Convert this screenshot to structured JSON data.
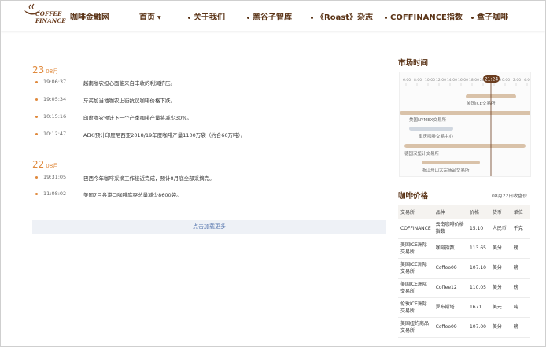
{
  "header": {
    "logo_text": "COFFEE\nFINANCE",
    "site_name": "咖啡金融网",
    "nav": [
      {
        "label": "首页"
      },
      {
        "label": "关于我们"
      },
      {
        "label": "黑谷子智库"
      },
      {
        "label": "《Roast》杂志"
      },
      {
        "label": "COFFINANCE指数"
      },
      {
        "label": "盒子咖啡"
      }
    ]
  },
  "news": {
    "groups": [
      {
        "day": "23",
        "month": "08月",
        "items": [
          {
            "time": "19:06:37",
            "title": "越南咖农担心面临来自丰收的利润挤压。"
          },
          {
            "time": "19:05:34",
            "title": "牙买加当地咖农上街抗议咖啡价格下跌。"
          },
          {
            "time": "10:15:16",
            "title": "印度咖农预计下一个产季咖啡产量将减少30%。"
          },
          {
            "time": "10:12:47",
            "title": "AEKI预计印度尼西亚2018/19年度咖啡产量1100万袋（约合66万吨）。"
          }
        ]
      },
      {
        "day": "22",
        "month": "08月",
        "items": [
          {
            "time": "19:31:05",
            "title": "巴西今年咖啡采摘工作接近完成，预计8月底全部采摘完。"
          },
          {
            "time": "11:08:02",
            "title": "美国7月各港口咖啡库存总量减少8600袋。"
          }
        ]
      }
    ],
    "load_more": "点击加载更多"
  },
  "market": {
    "title": "市场时间",
    "ticks": [
      "6:00",
      "8:00",
      "10:00",
      "12:00",
      "14:00",
      "16:00",
      "18:00",
      "20:00",
      "22:00",
      "0:00",
      "2:00",
      "4:00"
    ],
    "current_time": "21:24",
    "exchanges": [
      "美国ICE交易所",
      "美国NYMEX交易所",
      "重庆咖啡交易中心",
      "德国汉堡计交易所",
      "浙江舟山大宗商品交易所"
    ],
    "colors": {
      "bar": "#d9c2a9",
      "bar_grey": "#d0d7e0",
      "current": "#6b3d1f",
      "accent": "#e0893c"
    }
  },
  "prices": {
    "title": "咖啡价格",
    "date": "08月22日收盘价",
    "columns": [
      "交易所",
      "品种",
      "价格",
      "货币",
      "单位"
    ],
    "rows": [
      [
        "COFFINANCE",
        "云南咖啡价格指数",
        "15.10",
        "人民币",
        "千克"
      ],
      [
        "美国ICE洲际交易所",
        "咖啡指数",
        "113.65",
        "美分",
        "磅"
      ],
      [
        "美国ICE洲际交易所",
        "Coffee09",
        "107.10",
        "美分",
        "磅"
      ],
      [
        "美国ICE洲际交易所",
        "Coffee12",
        "110.05",
        "美分",
        "磅"
      ],
      [
        "伦敦ICE洲际交易所",
        "罗布斯塔",
        "1671",
        "美元",
        "吨"
      ],
      [
        "美国纽约商品交易所",
        "Coffee09",
        "107.00",
        "美分",
        "磅"
      ]
    ]
  }
}
